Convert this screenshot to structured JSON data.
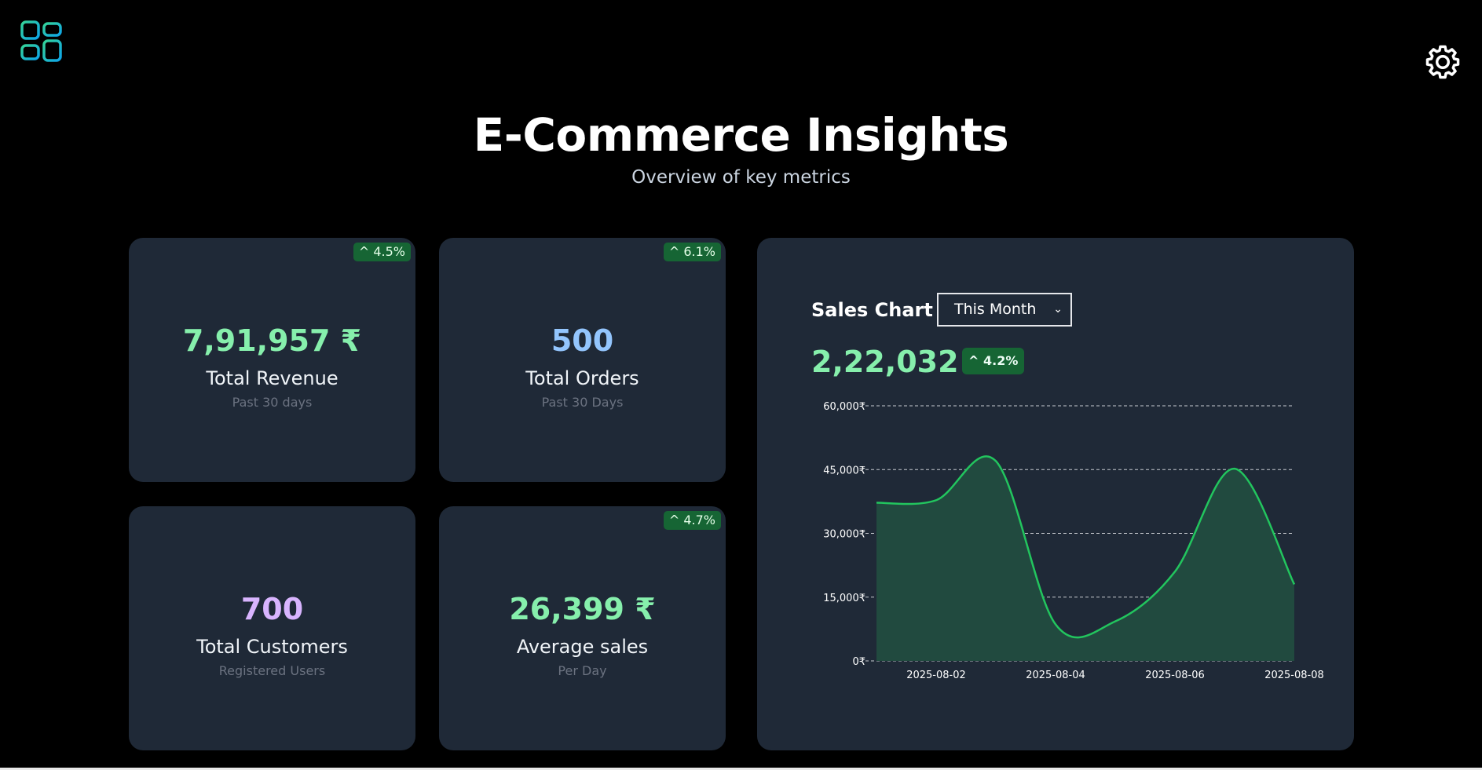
{
  "header": {
    "logo_icon": "grid-icon",
    "settings_icon": "gear-icon",
    "title": "E-Commerce Insights",
    "subtitle": "Overview of key metrics"
  },
  "colors": {
    "background": "#000000",
    "card": "#1f2937",
    "green_value": "#86efac",
    "blue_value": "#93c5fd",
    "purple_value": "#d8b4fe",
    "badge_bg": "#166534",
    "line": "#22c55e",
    "area": "#214a3f"
  },
  "cards": [
    {
      "value": "7,91,957 ₹",
      "label": "Total Revenue",
      "sub": "Past 30 days",
      "badge": "^ 4.5%"
    },
    {
      "value": "500",
      "label": "Total Orders",
      "sub": "Past 30 Days",
      "badge": "^ 6.1%"
    },
    {
      "value": "700",
      "label": "Total Customers",
      "sub": "Registered Users",
      "badge": ""
    },
    {
      "value": "26,399 ₹",
      "label": "Average sales",
      "sub": "Per Day",
      "badge": "^ 4.7%"
    }
  ],
  "sales_chart": {
    "title": "Sales Chart",
    "range_selected": "This Month",
    "total": "2,22,032 ₹",
    "badge": "^ 4.2%"
  },
  "chart_data": {
    "type": "area",
    "x": [
      "2025-08-01",
      "2025-08-02",
      "2025-08-03",
      "2025-08-04",
      "2025-08-05",
      "2025-08-06",
      "2025-08-07",
      "2025-08-08"
    ],
    "series": [
      {
        "values": [
          37200,
          37800,
          47000,
          8600,
          9300,
          21000,
          45200,
          18000
        ]
      }
    ],
    "xticks": [
      "2025-08-02",
      "2025-08-04",
      "2025-08-06",
      "2025-08-08"
    ],
    "yticks": [
      "0₹",
      "15,000₹",
      "30,000₹",
      "45,000₹",
      "60,000₹"
    ],
    "ylim": [
      0,
      60000
    ],
    "grid": "horizontal dashed",
    "legend": "none"
  }
}
